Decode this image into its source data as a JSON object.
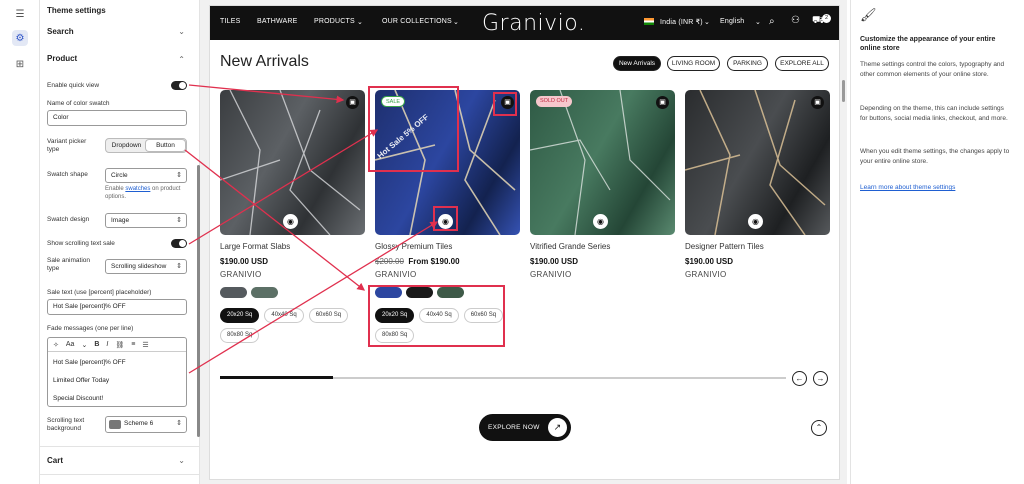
{
  "settings": {
    "title": "Theme settings",
    "search_label": "Search",
    "product_label": "Product",
    "enable_quick_view": "Enable quick view",
    "name_color_swatch": "Name of color swatch",
    "color_value": "Color",
    "variant_picker_type": "Variant picker\ntype",
    "variant_dropdown": "Dropdown",
    "variant_button": "Button",
    "swatch_shape": "Swatch shape",
    "swatch_shape_value": "Circle",
    "swatch_help_pre": "Enable",
    "swatch_help_link": "swatches",
    "swatch_help_post": "on product options.",
    "swatch_design": "Swatch design",
    "swatch_design_value": "Image",
    "show_scrolling": "Show scrolling text sale",
    "sale_animation": "Sale animation\ntype",
    "sale_animation_value": "Scrolling slideshow",
    "sale_text_label": "Sale text (use [percent] placeholder)",
    "sale_text_value": "Hot Sale [percent]% OFF",
    "fade_messages_label": "Fade messages (one per line)",
    "fade_lines": [
      "Hot Sale [percent]% OFF",
      "Limited Offer Today",
      "Special Discount!"
    ],
    "editor_aa": "Aa",
    "editor_bold": "B",
    "editor_italic": "I",
    "scroll_bg_label": "Scrolling text\nbackground",
    "scroll_bg_value": "Scheme 6",
    "cart_label": "Cart"
  },
  "store": {
    "nav": [
      "TILES",
      "BATHWARE",
      "PRODUCTS",
      "OUR COLLECTIONS"
    ],
    "logo": "Granivio.",
    "locale": "India (INR ₹)",
    "language": "English",
    "cart_count": "2",
    "section_title": "New Arrivals",
    "filters": [
      "New Arrivals",
      "LIVING ROOM",
      "PARKING",
      "EXPLORE ALL"
    ],
    "products": [
      {
        "title": "Large Format Slabs",
        "price": "$190.00 USD",
        "compare": "",
        "vendor": "GRANIVIO",
        "badge": "",
        "sizes": [
          "20x20 Sq",
          "40x40 Sq",
          "60x60 Sq",
          "80x80 Sq"
        ]
      },
      {
        "title": "Glossy Premium Tiles",
        "price": "From $190.00",
        "compare": "$200.00",
        "vendor": "GRANIVIO",
        "badge": "SALE",
        "sale_overlay": "Hot Sale 5% OFF",
        "sizes": [
          "20x20 Sq",
          "40x40 Sq",
          "60x60 Sq",
          "80x80 Sq"
        ]
      },
      {
        "title": "Vitrified Grande Series",
        "price": "$190.00 USD",
        "compare": "",
        "vendor": "GRANIVIO",
        "badge": "SOLD OUT"
      },
      {
        "title": "Designer Pattern Tiles",
        "price": "$190.00 USD",
        "compare": "",
        "vendor": "GRANIVIO",
        "badge": ""
      }
    ],
    "slider_progress": 0.2,
    "explore_label": "EXPLORE NOW"
  },
  "info": {
    "heading": "Customize the appearance of your entire online store",
    "p1": "Theme settings control the colors, typography and other common elements of your online store.",
    "p2": "Depending on the theme, this can include settings for buttons, social media links, checkout, and more.",
    "p3": "When you edit theme settings, the changes apply to your entire online store.",
    "link": "Learn more about theme settings"
  },
  "colors": {
    "accent": "#e0304e",
    "dark": "#111111",
    "link": "#1f5fd1"
  }
}
